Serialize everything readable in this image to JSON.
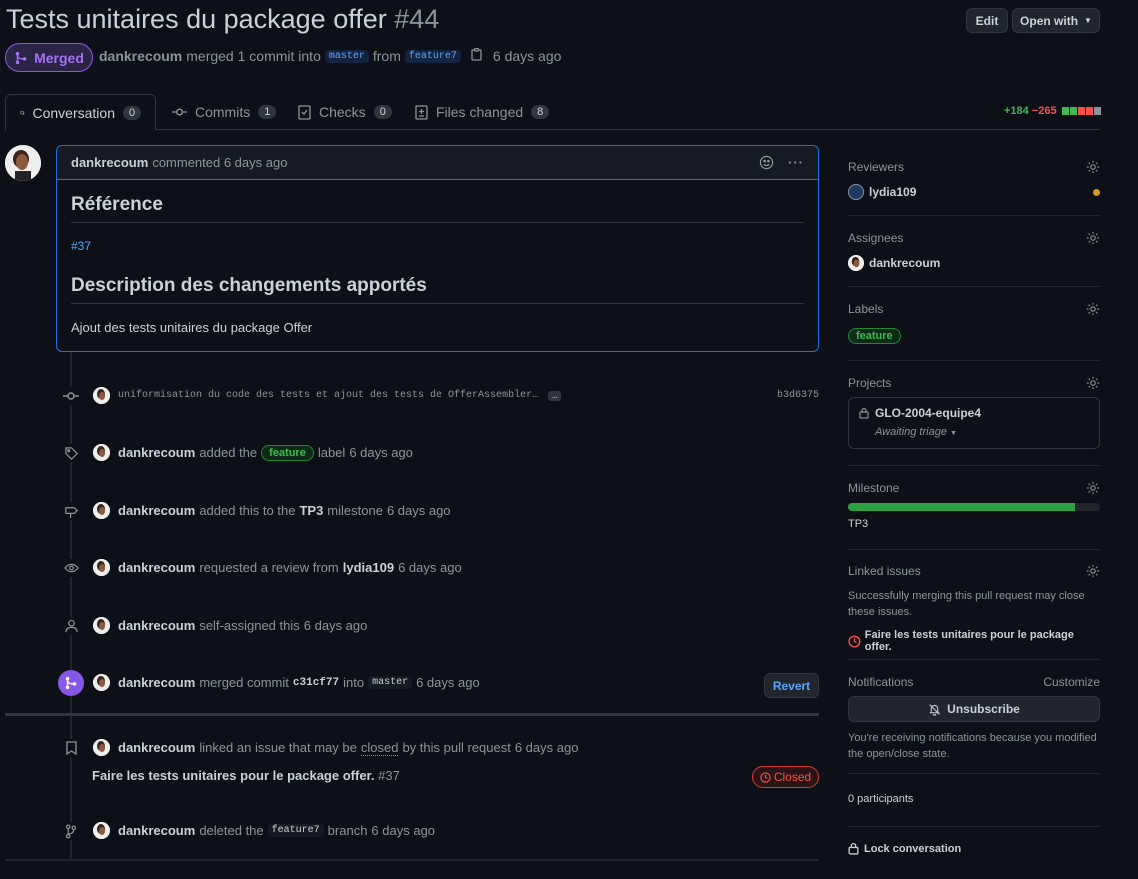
{
  "header": {
    "title": "Tests unitaires du package offer",
    "number": "#44",
    "edit_label": "Edit",
    "open_with_label": "Open with",
    "state": "Merged",
    "author": "dankrecoum",
    "merged_text": "merged 1 commit into",
    "base_branch": "master",
    "from_text": "from",
    "head_branch": "feature7",
    "time": "6 days ago"
  },
  "tabs": [
    {
      "label": "Conversation",
      "count": "0"
    },
    {
      "label": "Commits",
      "count": "1"
    },
    {
      "label": "Checks",
      "count": "0"
    },
    {
      "label": "Files changed",
      "count": "8"
    }
  ],
  "diffstat": {
    "additions": "+184",
    "deletions": "−265"
  },
  "comment": {
    "author": "dankrecoum",
    "meta": "commented 6 days ago",
    "heading1": "Référence",
    "issue_link": "#37",
    "heading2": "Description des changements apportés",
    "body": "Ajout des tests unitaires du package Offer"
  },
  "timeline": {
    "commit": {
      "message": "uniformisation du code des tests et ajout des tests de OfferAssembler…",
      "sha": "b3d6375"
    },
    "label_event": {
      "actor": "dankrecoum",
      "pre": "added the",
      "label": "feature",
      "post": "label",
      "time": "6 days ago"
    },
    "milestone_event": {
      "actor": "dankrecoum",
      "pre": "added this to the",
      "milestone": "TP3",
      "post": "milestone",
      "time": "6 days ago"
    },
    "review_event": {
      "actor": "dankrecoum",
      "pre": "requested a review from",
      "reviewer": "lydia109",
      "time": "6 days ago"
    },
    "assign_event": {
      "actor": "dankrecoum",
      "text": "self-assigned this",
      "time": "6 days ago"
    },
    "merge_event": {
      "actor": "dankrecoum",
      "pre": "merged commit",
      "sha": "c31cf77",
      "into": "into",
      "branch": "master",
      "time": "6 days ago",
      "revert_label": "Revert"
    },
    "link_event": {
      "actor": "dankrecoum",
      "text": "linked an issue that may be",
      "closed_word": "closed",
      "post": "by this pull request",
      "time": "6 days ago",
      "issue_title": "Faire les tests unitaires pour le package offer.",
      "issue_number": "#37",
      "issue_state": "Closed"
    },
    "delete_event": {
      "actor": "dankrecoum",
      "pre": "deleted the",
      "branch": "feature7",
      "post": "branch",
      "time": "6 days ago"
    }
  },
  "sidebar": {
    "reviewers": {
      "title": "Reviewers",
      "name": "lydia109"
    },
    "assignees": {
      "title": "Assignees",
      "name": "dankrecoum"
    },
    "labels": {
      "title": "Labels",
      "label": "feature"
    },
    "projects": {
      "title": "Projects",
      "name": "GLO-2004-equipe4",
      "status": "Awaiting triage"
    },
    "milestone": {
      "title": "Milestone",
      "name": "TP3",
      "progress": 0.9
    },
    "linked": {
      "title": "Linked issues",
      "desc": "Successfully merging this pull request may close these issues.",
      "issue": "Faire les tests unitaires pour le package offer."
    },
    "notifications": {
      "title": "Notifications",
      "customize": "Customize",
      "button": "Unsubscribe",
      "desc": "You're receiving notifications because you modified the open/close state."
    },
    "participants": "0 participants",
    "lock": "Lock conversation"
  }
}
